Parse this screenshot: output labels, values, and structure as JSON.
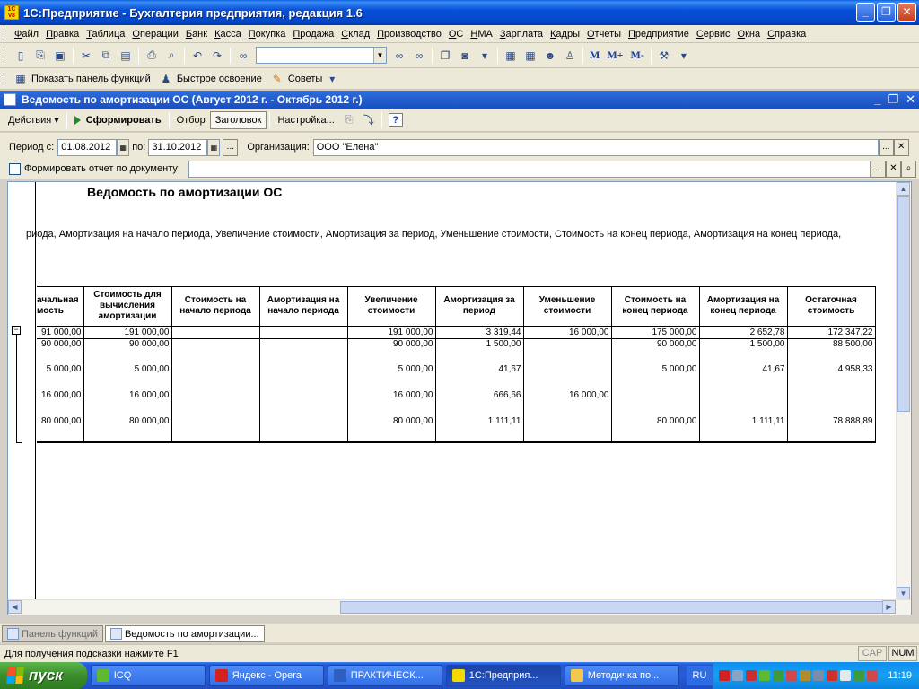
{
  "app": {
    "title": "1С:Предприятие - Бухгалтерия предприятия, редакция 1.6",
    "logo_top": "1С",
    "logo_bottom": "v8",
    "minimize": "_",
    "maximize": "❐",
    "close": "✕"
  },
  "menu": {
    "items": [
      "Файл",
      "Правка",
      "Таблица",
      "Операции",
      "Банк",
      "Касса",
      "Покупка",
      "Продажа",
      "Склад",
      "Производство",
      "ОС",
      "НМА",
      "Зарплата",
      "Кадры",
      "Отчеты",
      "Предприятие",
      "Сервис",
      "Окна",
      "Справка"
    ]
  },
  "toolbar2": {
    "show_panel": "Показать панель функций",
    "quick_learn": "Быстрое освоение",
    "tips": "Советы"
  },
  "toolbar1": {
    "m_buttons": [
      "M",
      "M+",
      "M-"
    ],
    "combo_value": ""
  },
  "child": {
    "title": "Ведомость по амортизации ОС (Август 2012 г. - Октябрь 2012 г.)",
    "toolbar": {
      "actions": "Действия",
      "generate": "Сформировать",
      "filter": "Отбор",
      "header": "Заголовок",
      "settings": "Настройка...",
      "help": "?"
    }
  },
  "form": {
    "period_from_label": "Период с:",
    "period_from": "01.08.2012",
    "period_to_label": "по:",
    "period_to": "31.10.2012",
    "org_label": "Организация:",
    "org_value": "ООО \"Елена\"",
    "by_document_label": "Формировать отчет по документу:",
    "by_document_value": "",
    "ellipsis": "...",
    "clear": "✕",
    "search": "⌕"
  },
  "report": {
    "title": "Ведомость по амортизации ОС",
    "columns_line": "риода, Амортизация на начало периода, Увеличение стоимости, Амортизация за период, Уменьшение стоимости, Стоимость на конец периода, Амортизация на конец периода,",
    "headers": [
      "ачальная\nмость",
      "Стоимость для вычисления амортизации",
      "Стоимость на начало периода",
      "Амортизация на начало периода",
      "Увеличение стоимости",
      "Амортизация за период",
      "Уменьшение стоимости",
      "Стоимость на конец периода",
      "Амортизация на конец периода",
      "Остаточная стоимость"
    ],
    "rows": [
      [
        "91 000,00",
        "191 000,00",
        "",
        "",
        "191 000,00",
        "3 319,44",
        "16 000,00",
        "175 000,00",
        "2 652,78",
        "172 347,22"
      ],
      [
        "90 000,00",
        "90 000,00",
        "",
        "",
        "90 000,00",
        "1 500,00",
        "",
        "90 000,00",
        "1 500,00",
        "88 500,00"
      ],
      [
        "5 000,00",
        "5 000,00",
        "",
        "",
        "5 000,00",
        "41,67",
        "",
        "5 000,00",
        "41,67",
        "4 958,33"
      ],
      [
        "16 000,00",
        "16 000,00",
        "",
        "",
        "16 000,00",
        "666,66",
        "16 000,00",
        "",
        "",
        ""
      ],
      [
        "80 000,00",
        "80 000,00",
        "",
        "",
        "80 000,00",
        "1 111,11",
        "",
        "80 000,00",
        "1 111,11",
        "78 888,89"
      ]
    ],
    "tree_toggle": "−"
  },
  "window_tabs": {
    "panel": "Панель функций",
    "report": "Ведомость по амортизации..."
  },
  "statusbar": {
    "hint": "Для получения подсказки нажмите F1",
    "cap": "CAP",
    "num": "NUM"
  },
  "taskbar": {
    "start": "пуск",
    "items": [
      {
        "label": "ICQ",
        "color": "#5fb830"
      },
      {
        "label": "Яндекс - Opera",
        "color": "#d42020"
      },
      {
        "label": "ПРАКТИЧЕСК...",
        "color": "#2f5ec0"
      },
      {
        "label": "1С:Предприя...",
        "color": "#f5d800"
      },
      {
        "label": "Методичка по...",
        "color": "#f2c94c"
      }
    ],
    "lang": "RU",
    "clock": "11:19"
  },
  "colors": {
    "title_blue": "#0850d8",
    "xp_green": "#3a8e2a",
    "window_bg": "#ece9d8"
  }
}
